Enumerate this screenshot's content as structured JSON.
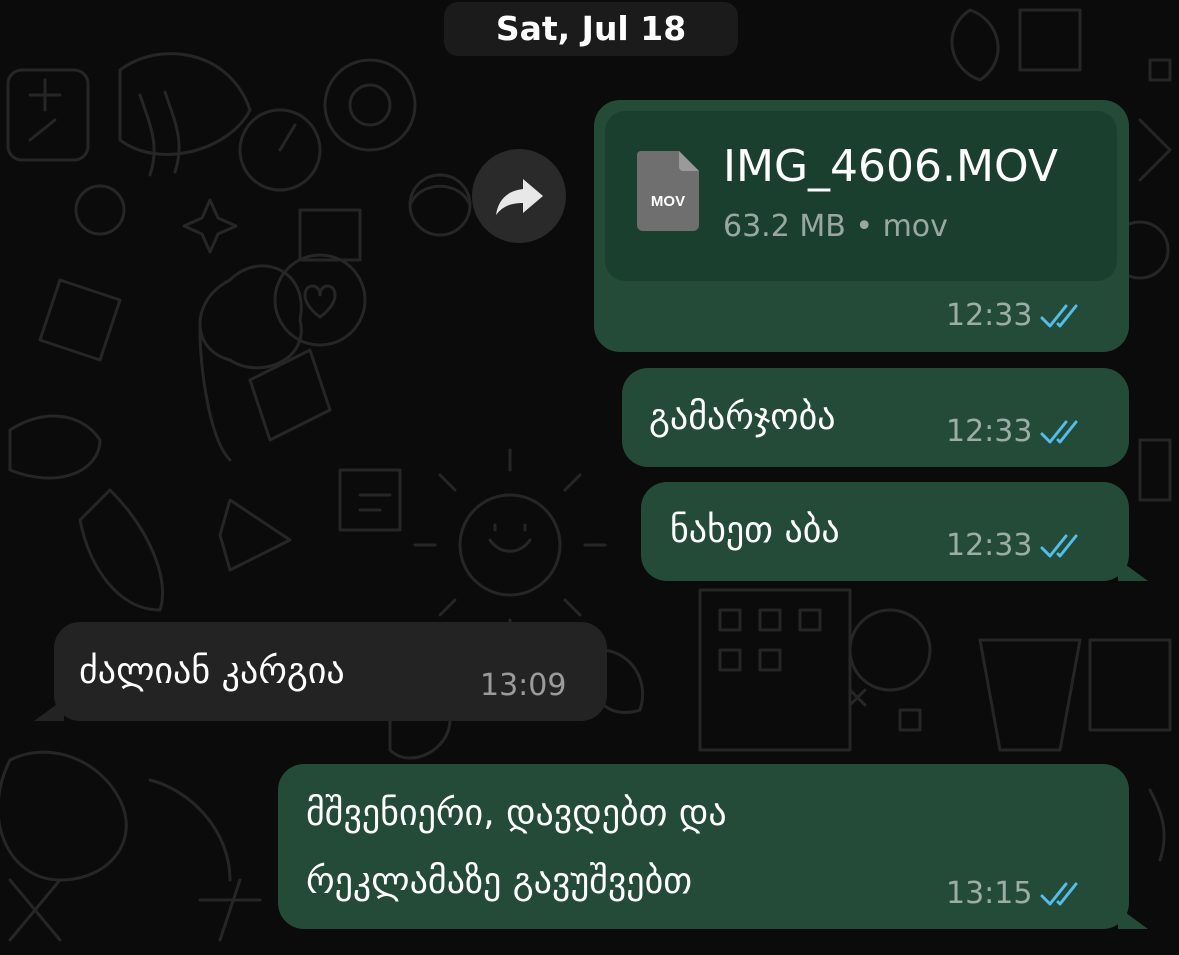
{
  "date_separator": "Sat, Jul 18",
  "colors": {
    "outgoing_bubble": "#234b38",
    "incoming_bubble": "#232323",
    "read_ticks": "#53bdeb",
    "background": "#0b0b0b"
  },
  "messages": [
    {
      "direction": "outgoing",
      "type": "file",
      "file": {
        "icon": "document-icon",
        "icon_label": "MOV",
        "name": "IMG_4606.MOV",
        "info": "63.2 MB • mov"
      },
      "time": "12:33",
      "status": "read"
    },
    {
      "direction": "outgoing",
      "text": "გამარჯობა",
      "time": "12:33",
      "status": "read"
    },
    {
      "direction": "outgoing",
      "text": "ნახეთ აბა",
      "time": "12:33",
      "status": "read"
    },
    {
      "direction": "incoming",
      "text": "ძალიან კარგია",
      "time": "13:09"
    },
    {
      "direction": "outgoing",
      "text_lines": [
        "მშვენიერი, დავდებთ და",
        "რეკლამაზე გავუშვებთ"
      ],
      "time": "13:15",
      "status": "read"
    }
  ],
  "forward_button": {
    "icon": "forward-icon"
  }
}
